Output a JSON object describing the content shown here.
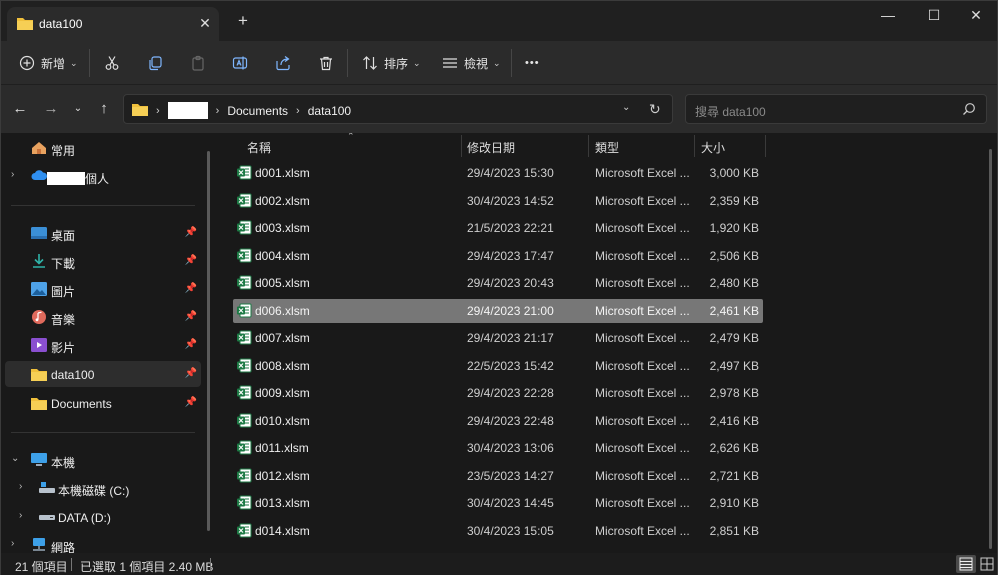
{
  "window": {
    "tab_title": "data100",
    "tab_close": "✕",
    "new_tab": "+",
    "minimize": "—",
    "maximize": "☐",
    "close": "✕"
  },
  "toolbar": {
    "new_label": "新增",
    "sort_label": "排序",
    "view_label": "檢視",
    "more_label": "•••"
  },
  "address": {
    "crumb_documents": "Documents",
    "crumb_folder": "data100"
  },
  "search": {
    "placeholder": "搜尋 data100"
  },
  "sidebar": {
    "home": "常用",
    "onedrive_suffix": "個人",
    "desktop": "桌面",
    "downloads": "下載",
    "pictures": "圖片",
    "music": "音樂",
    "videos": "影片",
    "data100": "data100",
    "documents": "Documents",
    "this_pc": "本機",
    "drive_c": "本機磁碟 (C:)",
    "drive_d": "DATA (D:)",
    "network": "網路"
  },
  "columns": {
    "name": "名稱",
    "modified": "修改日期",
    "type": "類型",
    "size": "大小"
  },
  "files": [
    {
      "name": "d001.xlsm",
      "date": "29/4/2023 15:30",
      "type": "Microsoft Excel ...",
      "size": "3,000 KB"
    },
    {
      "name": "d002.xlsm",
      "date": "30/4/2023 14:52",
      "type": "Microsoft Excel ...",
      "size": "2,359 KB"
    },
    {
      "name": "d003.xlsm",
      "date": "21/5/2023 22:21",
      "type": "Microsoft Excel ...",
      "size": "1,920 KB"
    },
    {
      "name": "d004.xlsm",
      "date": "29/4/2023 17:47",
      "type": "Microsoft Excel ...",
      "size": "2,506 KB"
    },
    {
      "name": "d005.xlsm",
      "date": "29/4/2023 20:43",
      "type": "Microsoft Excel ...",
      "size": "2,480 KB"
    },
    {
      "name": "d006.xlsm",
      "date": "29/4/2023 21:00",
      "type": "Microsoft Excel ...",
      "size": "2,461 KB"
    },
    {
      "name": "d007.xlsm",
      "date": "29/4/2023 21:17",
      "type": "Microsoft Excel ...",
      "size": "2,479 KB"
    },
    {
      "name": "d008.xlsm",
      "date": "22/5/2023 15:42",
      "type": "Microsoft Excel ...",
      "size": "2,497 KB"
    },
    {
      "name": "d009.xlsm",
      "date": "29/4/2023 22:28",
      "type": "Microsoft Excel ...",
      "size": "2,978 KB"
    },
    {
      "name": "d010.xlsm",
      "date": "29/4/2023 22:48",
      "type": "Microsoft Excel ...",
      "size": "2,416 KB"
    },
    {
      "name": "d011.xlsm",
      "date": "30/4/2023 13:06",
      "type": "Microsoft Excel ...",
      "size": "2,626 KB"
    },
    {
      "name": "d012.xlsm",
      "date": "23/5/2023 14:27",
      "type": "Microsoft Excel ...",
      "size": "2,721 KB"
    },
    {
      "name": "d013.xlsm",
      "date": "30/4/2023 14:45",
      "type": "Microsoft Excel ...",
      "size": "2,910 KB"
    },
    {
      "name": "d014.xlsm",
      "date": "30/4/2023 15:05",
      "type": "Microsoft Excel ...",
      "size": "2,851 KB"
    }
  ],
  "status": {
    "item_count": "21 個項目",
    "selection": "已選取 1 個項目 2.40 MB"
  },
  "colors": {
    "accent_folder": "#f0c03c",
    "excel_green": "#1d7a45",
    "selected_row": "#777777"
  }
}
